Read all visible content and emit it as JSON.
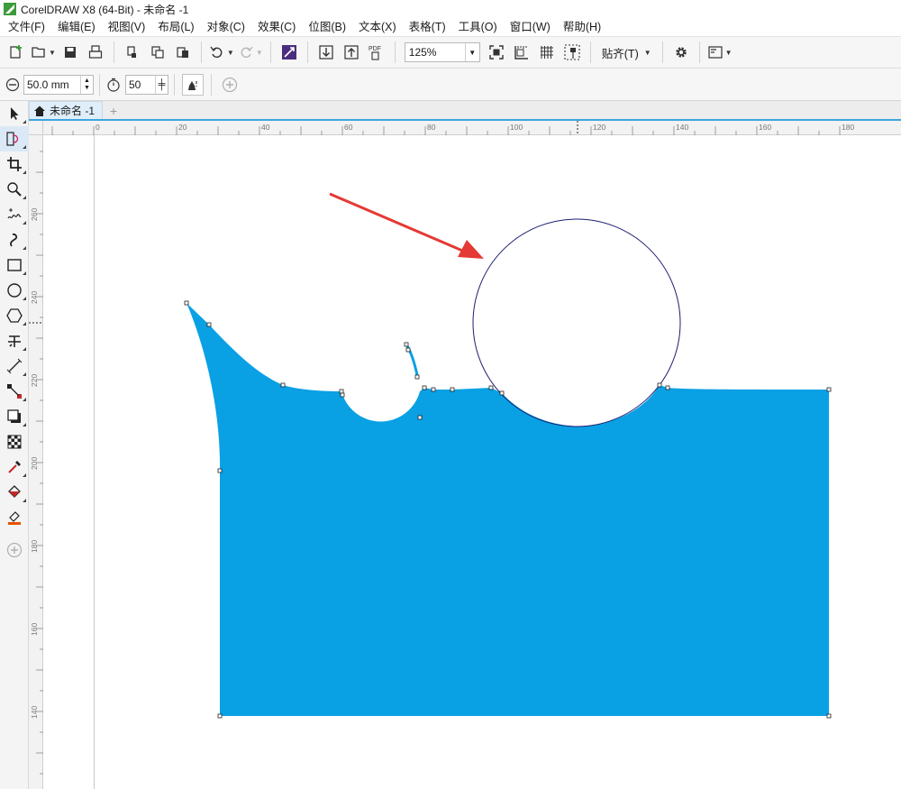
{
  "window": {
    "title": "CorelDRAW X8 (64-Bit) - 未命名 -1"
  },
  "menu": [
    {
      "label": "文件(F)",
      "name": "menu-file"
    },
    {
      "label": "编辑(E)",
      "name": "menu-edit"
    },
    {
      "label": "视图(V)",
      "name": "menu-view"
    },
    {
      "label": "布局(L)",
      "name": "menu-layout"
    },
    {
      "label": "对象(C)",
      "name": "menu-object"
    },
    {
      "label": "效果(C)",
      "name": "menu-effects"
    },
    {
      "label": "位图(B)",
      "name": "menu-bitmaps"
    },
    {
      "label": "文本(X)",
      "name": "menu-text"
    },
    {
      "label": "表格(T)",
      "name": "menu-table"
    },
    {
      "label": "工具(O)",
      "name": "menu-tools"
    },
    {
      "label": "窗口(W)",
      "name": "menu-window"
    },
    {
      "label": "帮助(H)",
      "name": "menu-help"
    }
  ],
  "toolbar": {
    "zoom_value": "125%",
    "snap_label": "贴齐(T)",
    "pdf_label": "PDF"
  },
  "property_bar": {
    "nib_size": "50.0 mm",
    "pressure_value": "50"
  },
  "document_tabs": [
    {
      "label": "未命名 -1"
    }
  ],
  "rulers": {
    "horizontal_labels": [
      "20",
      "0",
      "20",
      "40",
      "60",
      "80",
      "100",
      "120",
      "140",
      "160",
      "180"
    ],
    "vertical_labels": [
      "260",
      "240",
      "220",
      "200",
      "180",
      "160",
      "140"
    ]
  },
  "toolbox": [
    {
      "name": "pick-tool-icon",
      "icon": "arrow"
    },
    {
      "name": "shape-tool-icon",
      "icon": "shape"
    },
    {
      "name": "crop-tool-icon",
      "icon": "crop"
    },
    {
      "name": "zoom-tool-icon",
      "icon": "magnifier"
    },
    {
      "name": "freehand-tool-icon",
      "icon": "freehand"
    },
    {
      "name": "artistic-media-tool-icon",
      "icon": "brush"
    },
    {
      "name": "rectangle-tool-icon",
      "icon": "rectangle"
    },
    {
      "name": "ellipse-tool-icon",
      "icon": "ellipse"
    },
    {
      "name": "polygon-tool-icon",
      "icon": "polygon"
    },
    {
      "name": "text-tool-icon",
      "icon": "text"
    },
    {
      "name": "parallel-dimension-tool-icon",
      "icon": "dimension"
    },
    {
      "name": "connector-tool-icon",
      "icon": "connector"
    },
    {
      "name": "drop-shadow-tool-icon",
      "icon": "shadow"
    },
    {
      "name": "transparency-tool-icon",
      "icon": "checker"
    },
    {
      "name": "eyedropper-tool-icon",
      "icon": "eyedropper"
    },
    {
      "name": "interactive-fill-tool-icon",
      "icon": "fill"
    },
    {
      "name": "smart-fill-tool-icon",
      "icon": "smartfill"
    },
    {
      "name": "add-tool-icon",
      "icon": "plus"
    }
  ],
  "drawing": {
    "fill_color": "#0aa0e4",
    "circle_stroke": "#1e1e6e",
    "arrow_color": "#e53935"
  }
}
